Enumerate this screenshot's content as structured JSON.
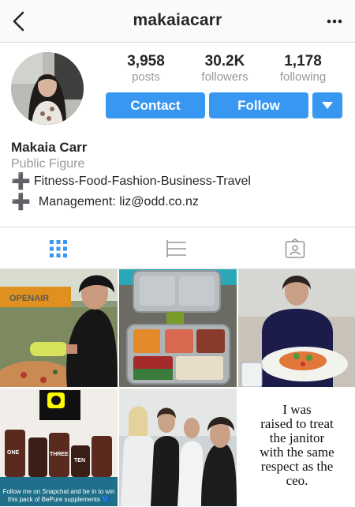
{
  "header": {
    "username": "makaiacarr",
    "back_icon": "chevron-left-icon",
    "more_icon": "ellipsis-icon"
  },
  "stats": {
    "posts": {
      "value": "3,958",
      "label": "posts"
    },
    "followers": {
      "value": "30.2K",
      "label": "followers"
    },
    "following": {
      "value": "1,178",
      "label": "following"
    }
  },
  "actions": {
    "contact_label": "Contact",
    "follow_label": "Follow",
    "accent": "#3897f0"
  },
  "profile": {
    "name": "Makaia Carr",
    "category": "Public Figure",
    "bio_line1": "Fitness-Food-Fashion-Business-Travel",
    "bio_line2": "Management: liz@odd.co.nz",
    "bio_bullet": "➕"
  },
  "tabs": [
    "grid-icon",
    "list-icon",
    "tagged-icon"
  ],
  "posts": {
    "post4_caption": "Follow me on Snapchat and be in to win this pack of BePure supplements 💙",
    "post4_jars": [
      "ONE",
      "THREE",
      "TEN"
    ],
    "post6_quote": [
      "I was",
      "raised to treat",
      "the janitor",
      "with the same",
      "respect as the",
      "ceo."
    ]
  }
}
